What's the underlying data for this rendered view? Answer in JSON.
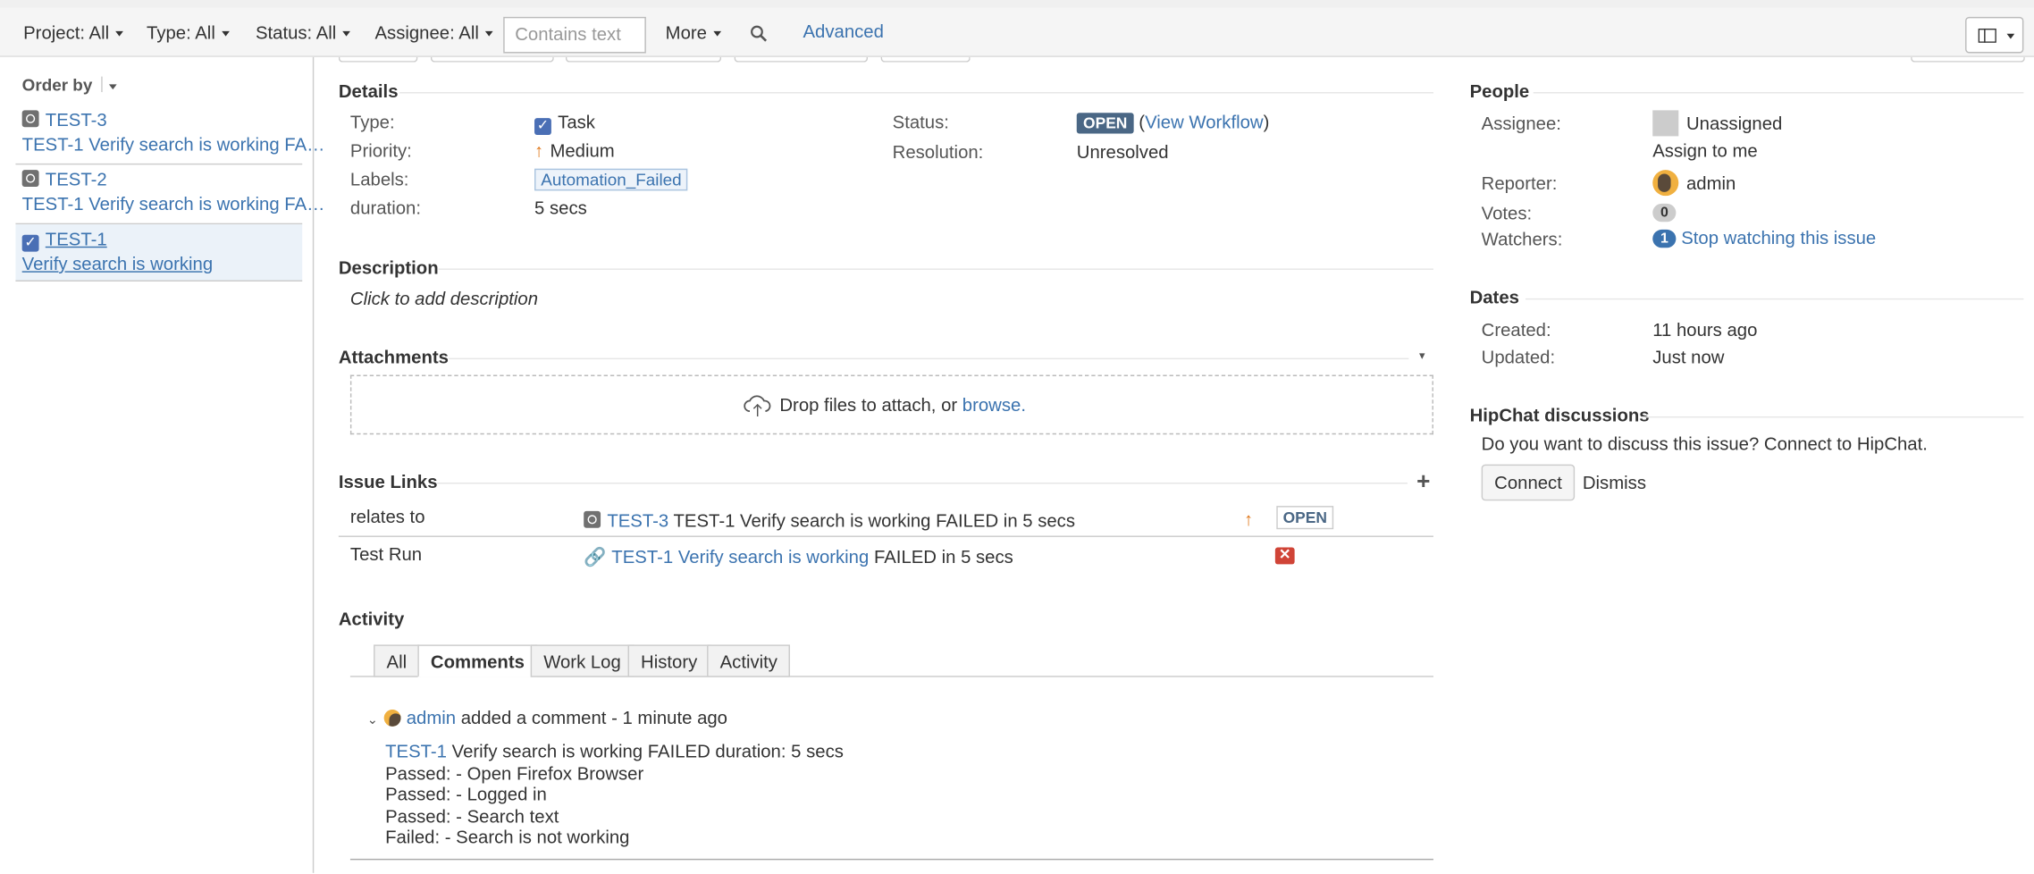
{
  "filters": {
    "project": "Project: All",
    "type": "Type: All",
    "status": "Status: All",
    "assignee": "Assignee: All",
    "search_placeholder": "Contains text",
    "more": "More",
    "advanced": "Advanced"
  },
  "sidebar": {
    "order_by": "Order by",
    "items": [
      {
        "key": "TEST-3",
        "summary": "TEST-1 Verify search is working FA…"
      },
      {
        "key": "TEST-2",
        "summary": "TEST-1 Verify search is working FA…"
      },
      {
        "key": "TEST-1",
        "summary": "Verify search is working"
      }
    ]
  },
  "details": {
    "heading": "Details",
    "type_label": "Type:",
    "type_value": "Task",
    "priority_label": "Priority:",
    "priority_value": "Medium",
    "labels_label": "Labels:",
    "labels_value": "Automation_Failed",
    "duration_label": "duration:",
    "duration_value": "5 secs",
    "status_label": "Status:",
    "status_value": "OPEN",
    "view_workflow": "View Workflow",
    "resolution_label": "Resolution:",
    "resolution_value": "Unresolved"
  },
  "description": {
    "heading": "Description",
    "placeholder": "Click to add description"
  },
  "attachments": {
    "heading": "Attachments",
    "drop_text": "Drop files to attach, or",
    "browse": "browse."
  },
  "issue_links": {
    "heading": "Issue Links",
    "rows": [
      {
        "relation": "relates to",
        "key": "TEST-3",
        "summary": "TEST-1 Verify search is working FAILED in 5 secs",
        "status": "OPEN"
      },
      {
        "relation": "Test Run",
        "link": "TEST-1 Verify search is working",
        "suffix": "FAILED in 5 secs"
      }
    ]
  },
  "activity": {
    "heading": "Activity",
    "tabs": [
      "All",
      "Comments",
      "Work Log",
      "History",
      "Activity"
    ],
    "comment": {
      "author": "admin",
      "meta": "added a comment - 1 minute ago",
      "lines": [
        {
          "key": "TEST-1",
          "text": "Verify search is working FAILED duration: 5 secs"
        },
        {
          "text": "Passed: - Open Firefox Browser"
        },
        {
          "text": "Passed: - Logged in"
        },
        {
          "text": "Passed: - Search text"
        },
        {
          "text": "Failed: - Search is not working"
        }
      ]
    }
  },
  "people": {
    "heading": "People",
    "assignee_label": "Assignee:",
    "assignee_value": "Unassigned",
    "assign_to_me": "Assign to me",
    "reporter_label": "Reporter:",
    "reporter_value": "admin",
    "votes_label": "Votes:",
    "votes_value": "0",
    "watchers_label": "Watchers:",
    "watchers_value": "1",
    "stop_watching": "Stop watching this issue"
  },
  "dates": {
    "heading": "Dates",
    "created_label": "Created:",
    "created_value": "11 hours ago",
    "updated_label": "Updated:",
    "updated_value": "Just now"
  },
  "hipchat": {
    "heading": "HipChat discussions",
    "text": "Do you want to discuss this issue? Connect to HipChat.",
    "connect": "Connect",
    "dismiss": "Dismiss"
  },
  "colors": {
    "link": "#3b73af",
    "status_badge": "#4a6785",
    "priority": "#e07a1f",
    "error": "#d04437"
  }
}
